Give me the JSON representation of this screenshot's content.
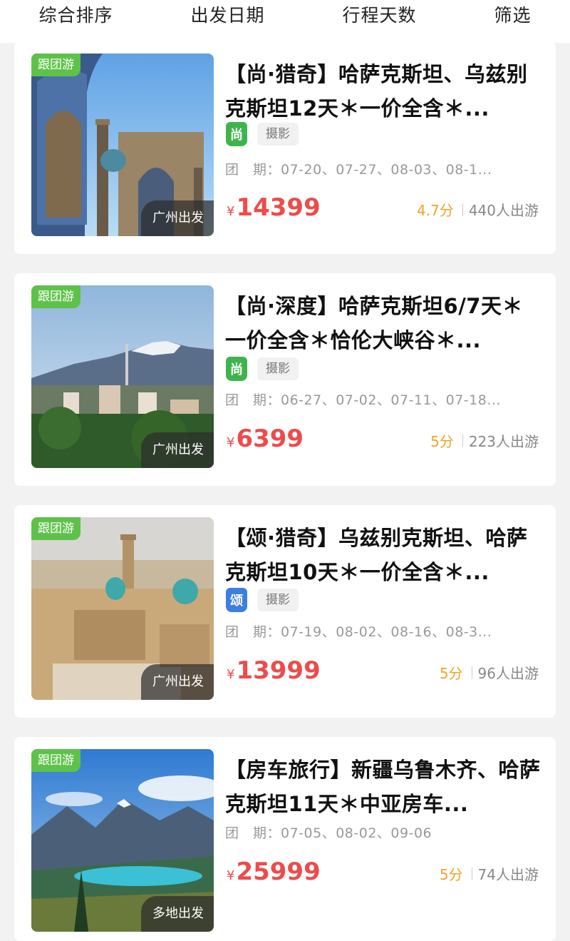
{
  "filter_bar": [
    "综合排序",
    "出发日期",
    "行程天数",
    "筛选"
  ],
  "colors": {
    "price": "#ec4c4c",
    "score": "#f0a428",
    "tag_green": "#5ec24a",
    "brand_green": "#3fb44c",
    "brand_blue": "#3d7fe0"
  },
  "cards": [
    {
      "tag": "跟团游",
      "departure": "广州出发",
      "title": "【尚·猎奇】哈萨克斯坦、乌兹别克斯坦12天＊一价全含＊...",
      "brand": "尚",
      "brand_color": "#3fb44c",
      "label": "摄影",
      "dates": "团　期：07-20、07-27、08-03、08-1...",
      "currency": "¥",
      "price": "14399",
      "score": "4.7分",
      "travelers": "440人出游",
      "image": "registan-madrasa"
    },
    {
      "tag": "跟团游",
      "departure": "广州出发",
      "title": "【尚·深度】哈萨克斯坦6/7天＊一价全含＊恰伦大峡谷＊...",
      "brand": "尚",
      "brand_color": "#3fb44c",
      "label": "摄影",
      "dates": "团　期：06-27、07-02、07-11、07-18...",
      "currency": "¥",
      "price": "6399",
      "score": "5分",
      "travelers": "223人出游",
      "image": "almaty-city-mountains"
    },
    {
      "tag": "跟团游",
      "departure": "广州出发",
      "title": "【颂·猎奇】乌兹别克斯坦、哈萨克斯坦10天＊一价全含＊...",
      "brand": "颂",
      "brand_color": "#3d7fe0",
      "label": "摄影",
      "dates": "团　期：07-19、08-02、08-16、08-3...",
      "currency": "¥",
      "price": "13999",
      "score": "5分",
      "travelers": "96人出游",
      "image": "bukhara-old-city"
    },
    {
      "tag": "跟团游",
      "departure": "多地出发",
      "title": "【房车旅行】新疆乌鲁木齐、哈萨克斯坦11天＊中亚房车...",
      "dates": "团　期：07-05、08-02、09-06",
      "currency": "¥",
      "price": "25999",
      "score": "5分",
      "travelers": "74人出游",
      "image": "mountain-lake"
    }
  ]
}
